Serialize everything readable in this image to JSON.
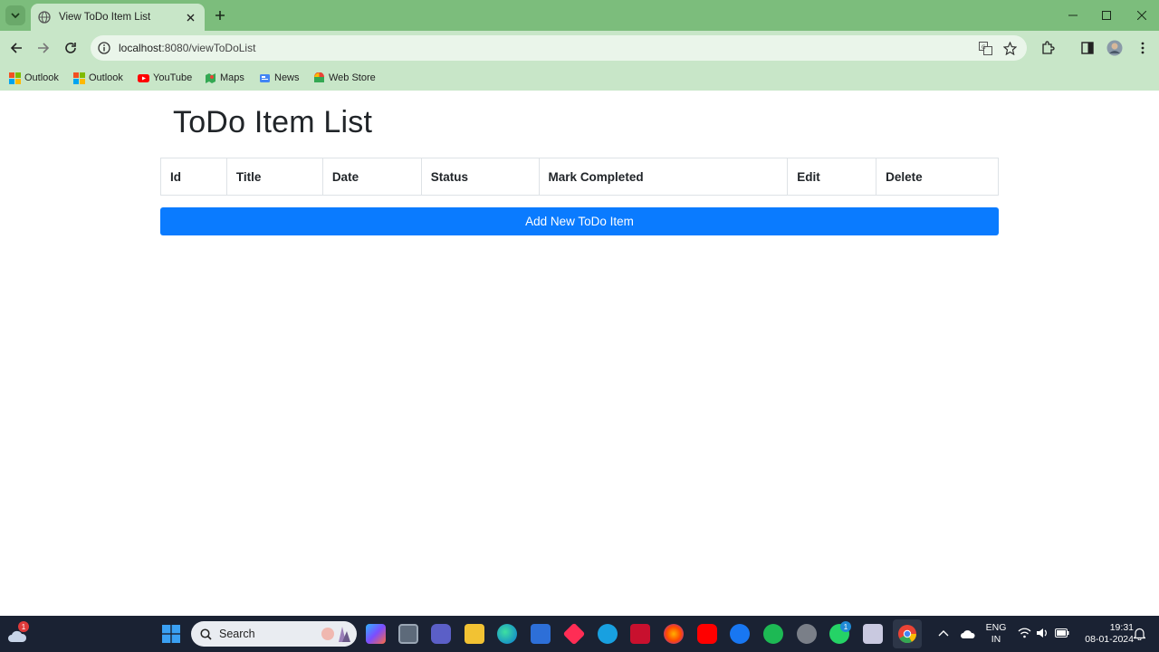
{
  "browser": {
    "tab_title": "View ToDo Item List",
    "url_host": "localhost",
    "url_rest": ":8080/viewToDoList",
    "bookmarks": [
      "Outlook",
      "Outlook",
      "YouTube",
      "Maps",
      "News",
      "Web Store"
    ]
  },
  "page": {
    "heading": "ToDo Item List",
    "table_headers": [
      "Id",
      "Title",
      "Date",
      "Status",
      "Mark Completed",
      "Edit",
      "Delete"
    ],
    "add_button_label": "Add New ToDo Item",
    "primary_color": "#0a7bff"
  },
  "taskbar": {
    "search_placeholder": "Search",
    "weather_badge": "1",
    "whatsapp_badge": "1",
    "lang_line1": "ENG",
    "lang_line2": "IN",
    "time": "19:31",
    "date": "08-01-2024"
  },
  "theme": {
    "chrome_tabstrip": "#7cbd7c",
    "chrome_toolbar": "#c8e6c8",
    "taskbar_bg": "#1a2233"
  }
}
